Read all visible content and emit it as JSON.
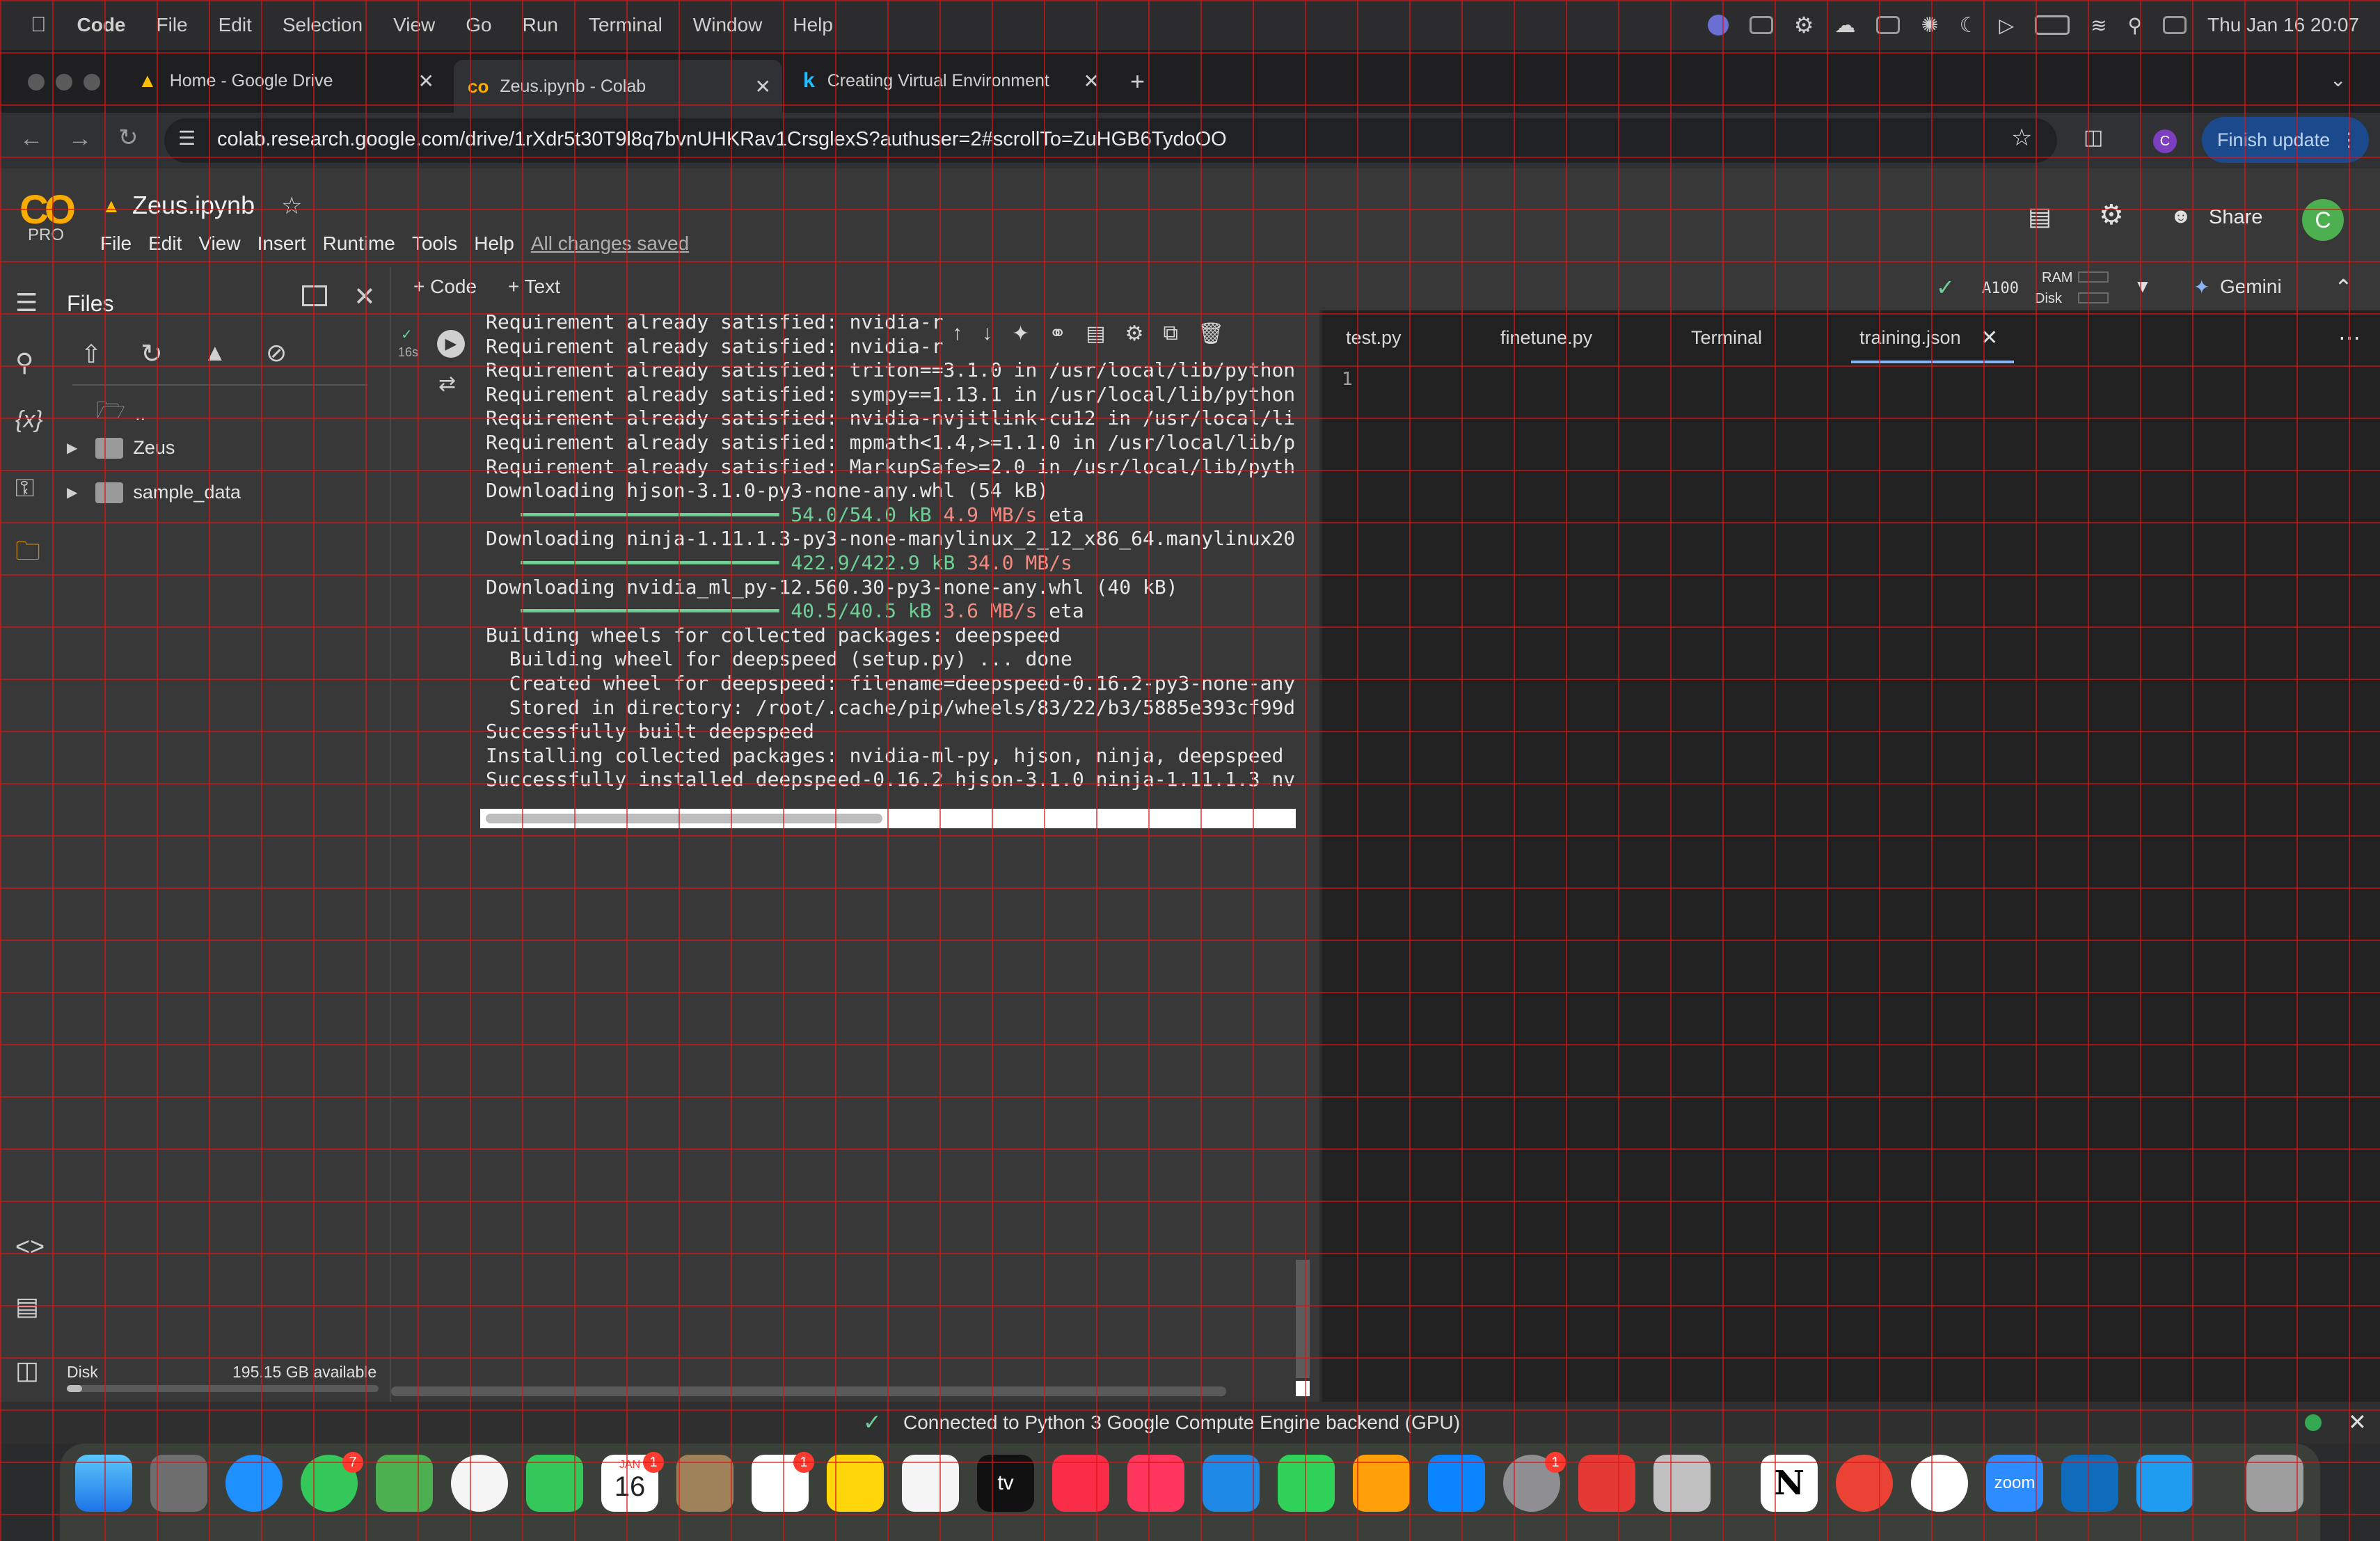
{
  "menubar": {
    "apple": "",
    "items": [
      "Code",
      "File",
      "Edit",
      "Selection",
      "View",
      "Go",
      "Run",
      "Terminal",
      "Window",
      "Help"
    ],
    "clock": "Thu Jan 16  20:07"
  },
  "browser": {
    "tabs": [
      {
        "title": "Home - Google Drive",
        "icon": "drive-icon"
      },
      {
        "title": "Zeus.ipynb - Colab",
        "icon": "colab-icon"
      },
      {
        "title": "Creating Virtual Environment",
        "icon": "k-icon"
      }
    ],
    "url": "colab.research.google.com/drive/1rXdr5t30T9l8q7bvnUHKRav1CrsglexS?authuser=2#scrollTo=ZuHGB6TydoOO",
    "finish_update": "Finish update"
  },
  "colab": {
    "logo": "CO",
    "pro": "PRO",
    "notebook_name": "Zeus.ipynb",
    "menu": [
      "File",
      "Edit",
      "View",
      "Insert",
      "Runtime",
      "Tools",
      "Help"
    ],
    "saved_status": "All changes saved",
    "share": "Share",
    "avatar": "C",
    "add_code": "+ Code",
    "add_text": "+ Text",
    "runtime_label": "A100",
    "ram": "RAM",
    "disk": "Disk",
    "gemini": "Gemini",
    "exec_time": "16s"
  },
  "files_panel": {
    "title": "Files",
    "parent": "..",
    "folders": [
      "Zeus",
      "sample_data"
    ],
    "disk_label": "Disk",
    "disk_available": "195.15 GB available",
    "disk_usage_fraction": 0.05
  },
  "output_lines": [
    "Requirement already satisfied: nvidia-r",
    "Requirement already satisfied: nvidia-r",
    "Requirement already satisfied: triton==3.1.0 in /usr/local/lib/python",
    "Requirement already satisfied: sympy==1.13.1 in /usr/local/lib/python",
    "Requirement already satisfied: nvidia-nvjitlink-cu12 in /usr/local/li",
    "Requirement already satisfied: mpmath<1.4,>=1.1.0 in /usr/local/lib/p",
    "Requirement already satisfied: MarkupSafe>=2.0 in /usr/local/lib/pyth",
    "Downloading hjson-3.1.0-py3-none-any.whl (54 kB)"
  ],
  "progress1": {
    "done": "54.0/54.0 kB",
    "speed": "4.9 MB/s",
    "eta": "eta"
  },
  "output_line2": "Downloading ninja-1.11.1.3-py3-none-manylinux_2_12_x86_64.manylinux20",
  "progress2": {
    "done": "422.9/422.9 kB",
    "speed": "34.0 MB/s"
  },
  "output_line3": "Downloading nvidia_ml_py-12.560.30-py3-none-any.whl (40 kB)",
  "progress3": {
    "done": "40.5/40.5 kB",
    "speed": "3.6 MB/s",
    "eta": "eta"
  },
  "output_tail": [
    "Building wheels for collected packages: deepspeed",
    "  Building wheel for deepspeed (setup.py) ... done",
    "  Created wheel for deepspeed: filename=deepspeed-0.16.2-py3-none-any",
    "  Stored in directory: /root/.cache/pip/wheels/83/22/b3/5885e393cf99d",
    "Successfully built deepspeed",
    "Installing collected packages: nvidia-ml-py, hjson, ninja, deepspeed",
    "Successfully installed deepspeed-0.16.2 hjson-3.1.0 ninja-1.11.1.3 nv"
  ],
  "editor": {
    "tabs": [
      "test.py",
      "finetune.py",
      "Terminal",
      "training.json"
    ],
    "active_tab": "training.json",
    "line_number": "1"
  },
  "status": {
    "text": "Connected to Python 3 Google Compute Engine backend (GPU)"
  },
  "dock": {
    "calendar_month": "JAN",
    "calendar_day": "16",
    "badges": {
      "messages": "7",
      "calendar": "1",
      "reminders": "1",
      "settings": "1"
    },
    "tv_label": "tv",
    "zoom_label": "zoom"
  },
  "colors": {
    "accent": "#f9ab00",
    "ok_green": "#6fcf97",
    "speed_red": "#f28b82",
    "grid_red": "#dc1414"
  }
}
